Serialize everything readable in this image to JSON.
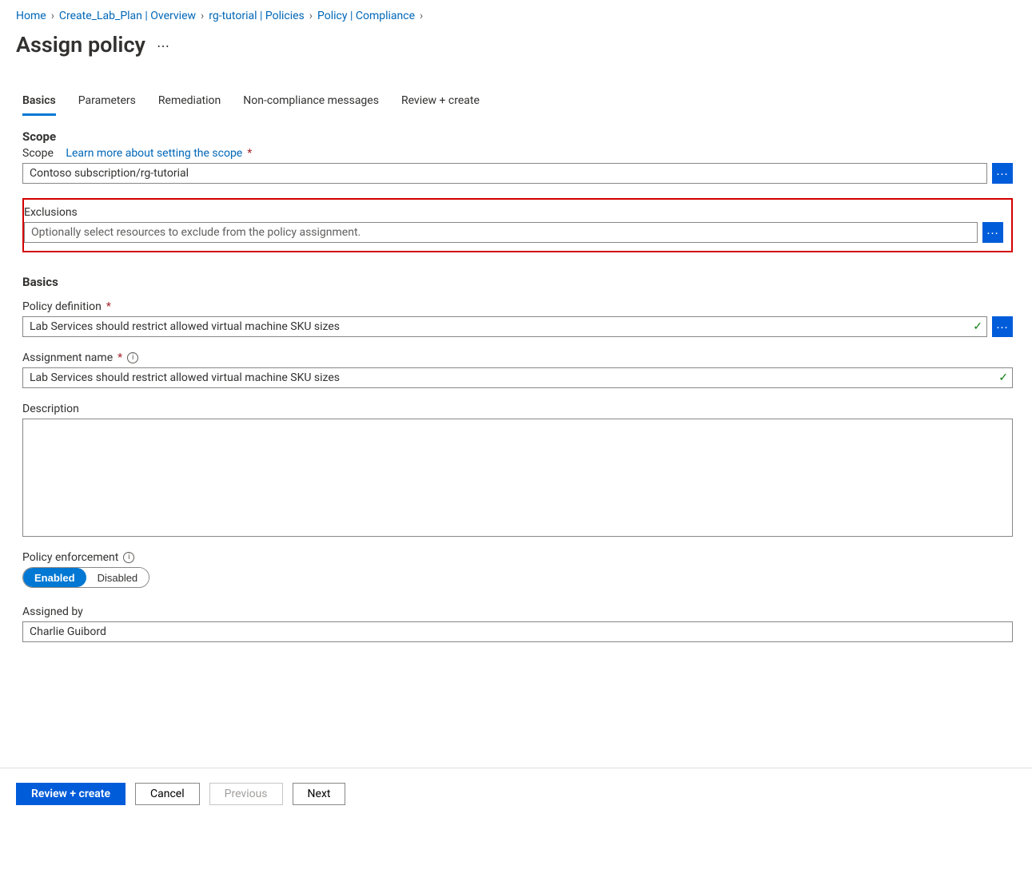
{
  "breadcrumb": [
    {
      "label": "Home"
    },
    {
      "label": "Create_Lab_Plan | Overview"
    },
    {
      "label": "rg-tutorial | Policies"
    },
    {
      "label": "Policy | Compliance"
    }
  ],
  "page_title": "Assign policy",
  "tabs": [
    {
      "label": "Basics",
      "active": true
    },
    {
      "label": "Parameters"
    },
    {
      "label": "Remediation"
    },
    {
      "label": "Non-compliance messages"
    },
    {
      "label": "Review + create"
    }
  ],
  "sections": {
    "scope": {
      "heading": "Scope",
      "scope_label": "Scope",
      "learn_more": "Learn more about setting the scope",
      "scope_value": "Contoso subscription/rg-tutorial",
      "exclusions_label": "Exclusions",
      "exclusions_placeholder": "Optionally select resources to exclude from the policy assignment."
    },
    "basics": {
      "heading": "Basics",
      "policy_def_label": "Policy definition",
      "policy_def_value": "Lab Services should restrict allowed virtual machine SKU sizes",
      "assignment_name_label": "Assignment name",
      "assignment_name_value": "Lab Services should restrict allowed virtual machine SKU sizes",
      "description_label": "Description",
      "description_value": "",
      "enforcement_label": "Policy enforcement",
      "enforcement_enabled": "Enabled",
      "enforcement_disabled": "Disabled",
      "assigned_by_label": "Assigned by",
      "assigned_by_value": "Charlie Guibord"
    }
  },
  "footer": {
    "review_create": "Review + create",
    "cancel": "Cancel",
    "previous": "Previous",
    "next": "Next"
  },
  "glyphs": {
    "chevron": "›",
    "ellipsis": "…",
    "dots": "⋯",
    "check": "✓",
    "info": "i"
  }
}
